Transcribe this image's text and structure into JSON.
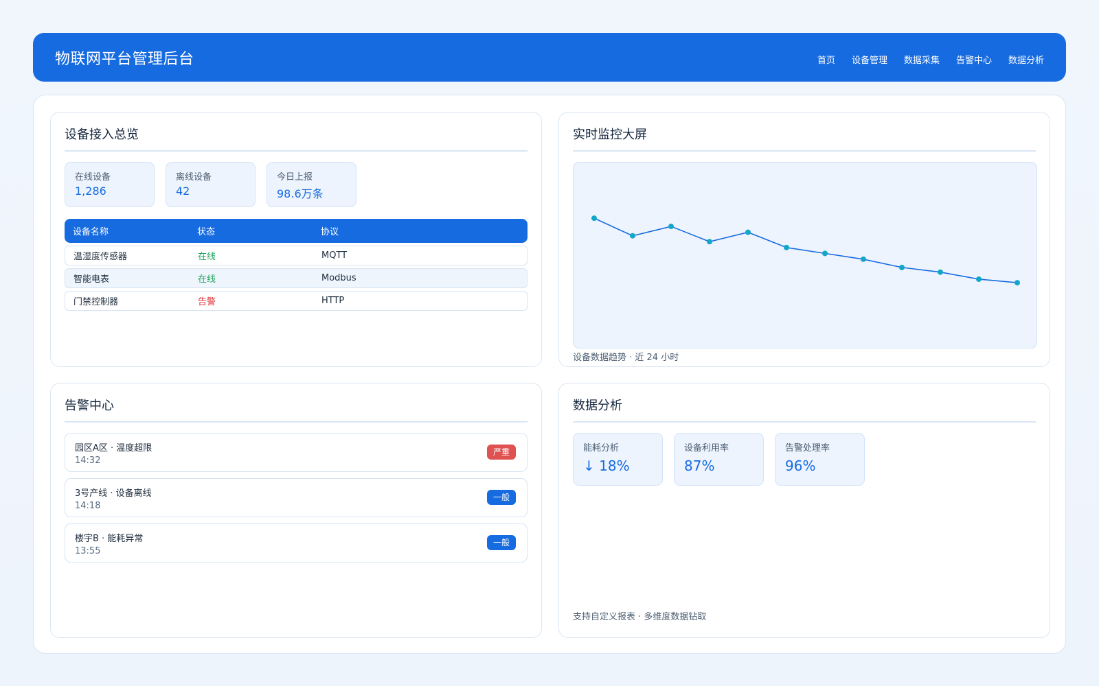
{
  "header": {
    "title": "物联网平台管理后台",
    "nav": [
      "首页",
      "设备管理",
      "数据采集",
      "告警中心",
      "数据分析"
    ]
  },
  "overview": {
    "title": "设备接入总览",
    "stats": [
      {
        "label": "在线设备",
        "value": "1,286"
      },
      {
        "label": "离线设备",
        "value": "42"
      },
      {
        "label": "今日上报",
        "value": "98.6万条"
      }
    ],
    "table": {
      "headers": [
        "设备名称",
        "状态",
        "协议"
      ],
      "rows": [
        {
          "name": "温湿度传感器",
          "status": "在线",
          "protocol": "MQTT"
        },
        {
          "name": "智能电表",
          "status": "在线",
          "protocol": "Modbus"
        },
        {
          "name": "门禁控制器",
          "status": "告警",
          "protocol": "HTTP"
        }
      ]
    }
  },
  "monitor": {
    "title": "实时监控大屏",
    "caption": "设备数据趋势 · 近 24 小时"
  },
  "chart_data": {
    "type": "line",
    "title": "",
    "xlabel": "",
    "ylabel": "",
    "grid": false,
    "x": [
      1,
      2,
      3,
      4,
      5,
      6,
      7,
      8,
      9,
      10,
      11,
      12
    ],
    "series": [
      {
        "values": [
          100,
          85,
          93,
          80,
          88,
          75,
          70,
          65,
          58,
          54,
          48,
          45
        ]
      }
    ],
    "ylim": [
      0,
      110
    ],
    "line_color": "#176be0",
    "point_color": "#13a6c8"
  },
  "alerts": {
    "title": "告警中心",
    "items": [
      {
        "text": "园区A区 · 温度超限",
        "time": "14:32",
        "level": "严重",
        "color": "#e05252"
      },
      {
        "text": "3号产线 · 设备离线",
        "time": "14:18",
        "level": "一般",
        "color": "#176be0"
      },
      {
        "text": "楼宇B · 能耗异常",
        "time": "13:55",
        "level": "一般",
        "color": "#176be0"
      }
    ]
  },
  "analysis": {
    "title": "数据分析",
    "stats": [
      {
        "label": "能耗分析",
        "value": "↓ 18%"
      },
      {
        "label": "设备利用率",
        "value": "87%"
      },
      {
        "label": "告警处理率",
        "value": "96%"
      }
    ],
    "footnote": "支持自定义报表 · 多维度数据钻取"
  }
}
